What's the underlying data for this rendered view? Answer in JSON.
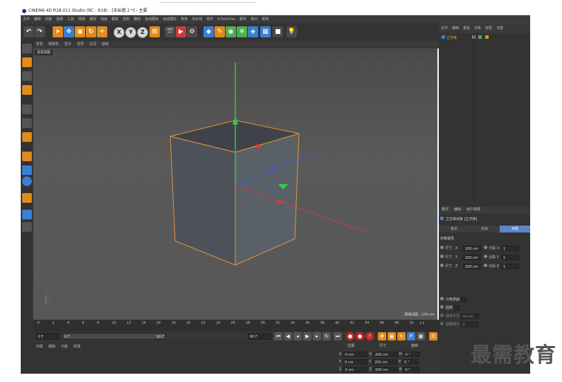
{
  "window": {
    "title": "CINEMA 4D R18.011 Studio (RC - R18) - [未标题 2 *] - 主要"
  },
  "menubar": [
    "文件",
    "编辑",
    "创建",
    "选择",
    "工具",
    "网格",
    "捕捉",
    "动画",
    "模拟",
    "渲染",
    "雕刻",
    "运动跟踪",
    "运动图形",
    "角色",
    "流水线",
    "插件",
    "X-Particles",
    "脚本",
    "窗口",
    "帮助"
  ],
  "toolbar": {
    "icons": [
      "undo-icon",
      "redo-icon",
      "select-arrow-icon",
      "move-icon",
      "scale-icon",
      "rotate-icon",
      "last-tool-icon",
      "x-axis-icon",
      "y-axis-icon",
      "z-axis-icon",
      "coordinate-system-icon",
      "render-region-icon",
      "render-view-icon",
      "render-settings-icon",
      "cube-icon",
      "pen-icon",
      "subdivision-icon",
      "array-icon",
      "deformer-icon",
      "floor-icon",
      "camera-icon",
      "light-icon"
    ],
    "axis_labels": [
      "X",
      "Y",
      "Z"
    ]
  },
  "viewport": {
    "menu": [
      "查看",
      "摄像机",
      "显示",
      "选项",
      "过滤",
      "面板"
    ],
    "label": "透视视图",
    "grid_info": "网格间距 : 100 cm"
  },
  "timeline": {
    "ticks": [
      "0",
      "2",
      "4",
      "6",
      "8",
      "10",
      "12",
      "14",
      "16",
      "18",
      "20",
      "22",
      "24",
      "26",
      "28",
      "30",
      "32",
      "34",
      "36",
      "38",
      "40",
      "42",
      "44",
      "46",
      "48",
      "50"
    ],
    "end_label": "0 F",
    "start_frame": "0 F",
    "current_frame": "0 F",
    "range_end": "90 F",
    "max_frame": "90 F"
  },
  "materials_panel": {
    "tabs": [
      "创建",
      "编辑",
      "功能",
      "纹理"
    ]
  },
  "coords_panel": {
    "headers": [
      "位置",
      "尺寸",
      "旋转"
    ],
    "rows": [
      {
        "axis": "X",
        "pos": "0 cm",
        "size": "200 cm",
        "rot_axis": "H",
        "rot": "0 °"
      },
      {
        "axis": "Y",
        "pos": "0 cm",
        "size": "200 cm",
        "rot_axis": "P",
        "rot": "0 °"
      },
      {
        "axis": "Z",
        "pos": "0 cm",
        "size": "200 cm",
        "rot_axis": "B",
        "rot": "0 °"
      }
    ]
  },
  "object_manager": {
    "menu": [
      "文件",
      "编辑",
      "查看",
      "对象",
      "标签",
      "书签"
    ],
    "object_name": "立方体"
  },
  "attributes": {
    "menu": [
      "模式",
      "编辑",
      "用户数据"
    ],
    "title": "立方体对象 [立方体]",
    "tabs": [
      "基本",
      "坐标",
      "对象"
    ],
    "active_tab": "对象",
    "section": "对象属性",
    "size_rows": [
      {
        "label": "尺寸 . X",
        "value": "200 cm",
        "seg_label": "分段 X",
        "seg": "1"
      },
      {
        "label": "尺寸 . Y",
        "value": "200 cm",
        "seg_label": "分段 Y",
        "seg": "1"
      },
      {
        "label": "尺寸 . Z",
        "value": "200 cm",
        "seg_label": "分段 Z",
        "seg": "1"
      }
    ],
    "separate_surfaces": "分离表面",
    "fillet": "圆角",
    "fillet_radius_label": "圆角半径",
    "fillet_radius": "40 cm",
    "fillet_subdiv_label": "圆角细分",
    "fillet_subdiv": "5"
  },
  "watermark": "最需教育",
  "colors": {
    "accent": "#e28a1c",
    "active_tab": "#5b86c9",
    "viewport": "#555555"
  }
}
